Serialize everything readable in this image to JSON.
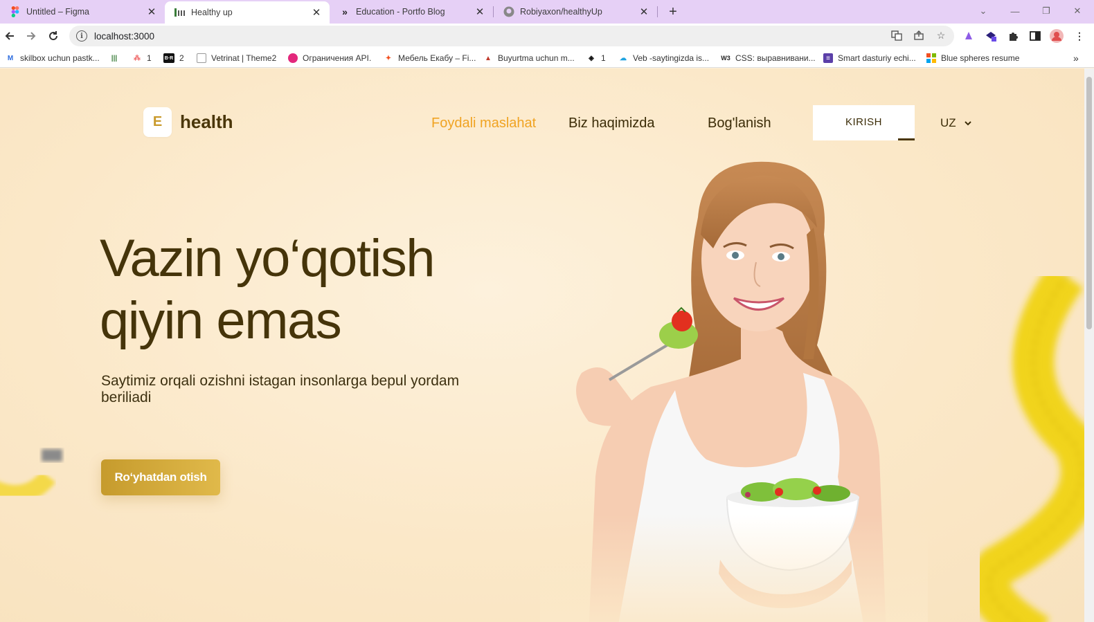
{
  "browser": {
    "tabs": [
      {
        "title": "Untitled – Figma",
        "icon": "figma-icon"
      },
      {
        "title": "Healthy up",
        "icon": "healthy-favicon",
        "active": true
      },
      {
        "title": "Education - Portfo Blog",
        "icon": "double-chevron-icon"
      },
      {
        "title": "Robiyaxon/healthyUp",
        "icon": "github-icon"
      }
    ],
    "url": "localhost:3000",
    "bookmarks": [
      {
        "label": "skilbox uchun pastk..."
      },
      {
        "label": ""
      },
      {
        "label": "1"
      },
      {
        "label": "2"
      },
      {
        "label": "Vetrinat | Theme2"
      },
      {
        "label": "Ограничения API."
      },
      {
        "label": "Мебель Екабу – Fi..."
      },
      {
        "label": "Buyurtma uchun m..."
      },
      {
        "label": "1"
      },
      {
        "label": "Veb -saytingizda is..."
      },
      {
        "label": "CSS: выравнивани..."
      },
      {
        "label": "Smart dasturiy echi..."
      },
      {
        "label": "Blue spheres resume"
      }
    ]
  },
  "header": {
    "logo_mark": "E",
    "logo_text": "health",
    "nav": [
      "Foydali maslahat",
      "Biz haqimizda",
      "Bog'lanish"
    ],
    "login": "KIRISH",
    "lang": "UZ"
  },
  "hero": {
    "title_line1": "Vazin yo‘qotish",
    "title_line2": "qiyin emas",
    "subtitle": "Saytimiz orqali ozishni istagan insonlarga bepul yordam beriliadi",
    "cta": "Ro‘yhatdan otish"
  },
  "colors": {
    "accent": "#f0a322",
    "brand_dark": "#45340a",
    "cta_gold": "#d4a93a",
    "page_bg": "#fbe8c8",
    "tabbar": "#e6d0f6"
  }
}
